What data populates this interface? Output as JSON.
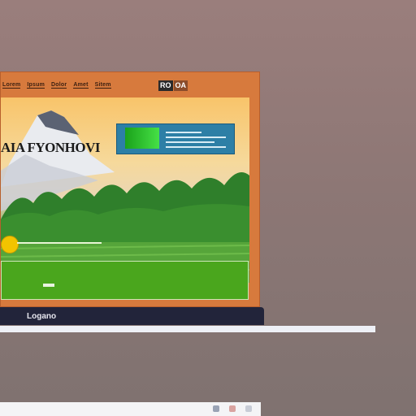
{
  "nav": {
    "links": [
      "Lorem",
      "Ipsum",
      "Dolor",
      "Amet",
      "Sitem"
    ]
  },
  "logo": {
    "left": "RO",
    "right": "OA"
  },
  "hero": {
    "title": "AIA FYONHOVI"
  },
  "taskbar": {
    "label": "Logano"
  },
  "colors": {
    "frame": "#d77a3d",
    "taskbar": "#22243a",
    "green_bar": "#4aa61d",
    "info_card": "#2d7fa6",
    "slider_dot": "#f2c400"
  },
  "icons": [
    "slider-handle-icon",
    "info-thumbnail-icon",
    "tray-icon-gray",
    "tray-icon-red"
  ]
}
